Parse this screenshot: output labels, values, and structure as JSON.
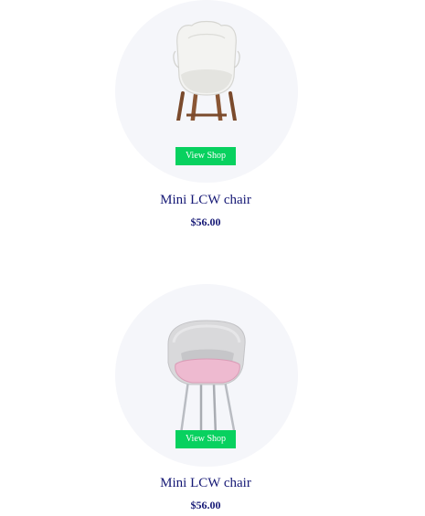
{
  "products": [
    {
      "name": "Mini LCW chair",
      "price": "$56.00",
      "button_label": "View Shop",
      "image": "white-shell-chair-wooden-legs"
    },
    {
      "name": "Mini LCW chair",
      "price": "$56.00",
      "button_label": "View Shop",
      "image": "grey-upholstered-chair-pink-cushion"
    }
  ],
  "colors": {
    "circle_bg": "#f5f6fa",
    "button_bg": "#08d15f",
    "text": "#151875"
  }
}
